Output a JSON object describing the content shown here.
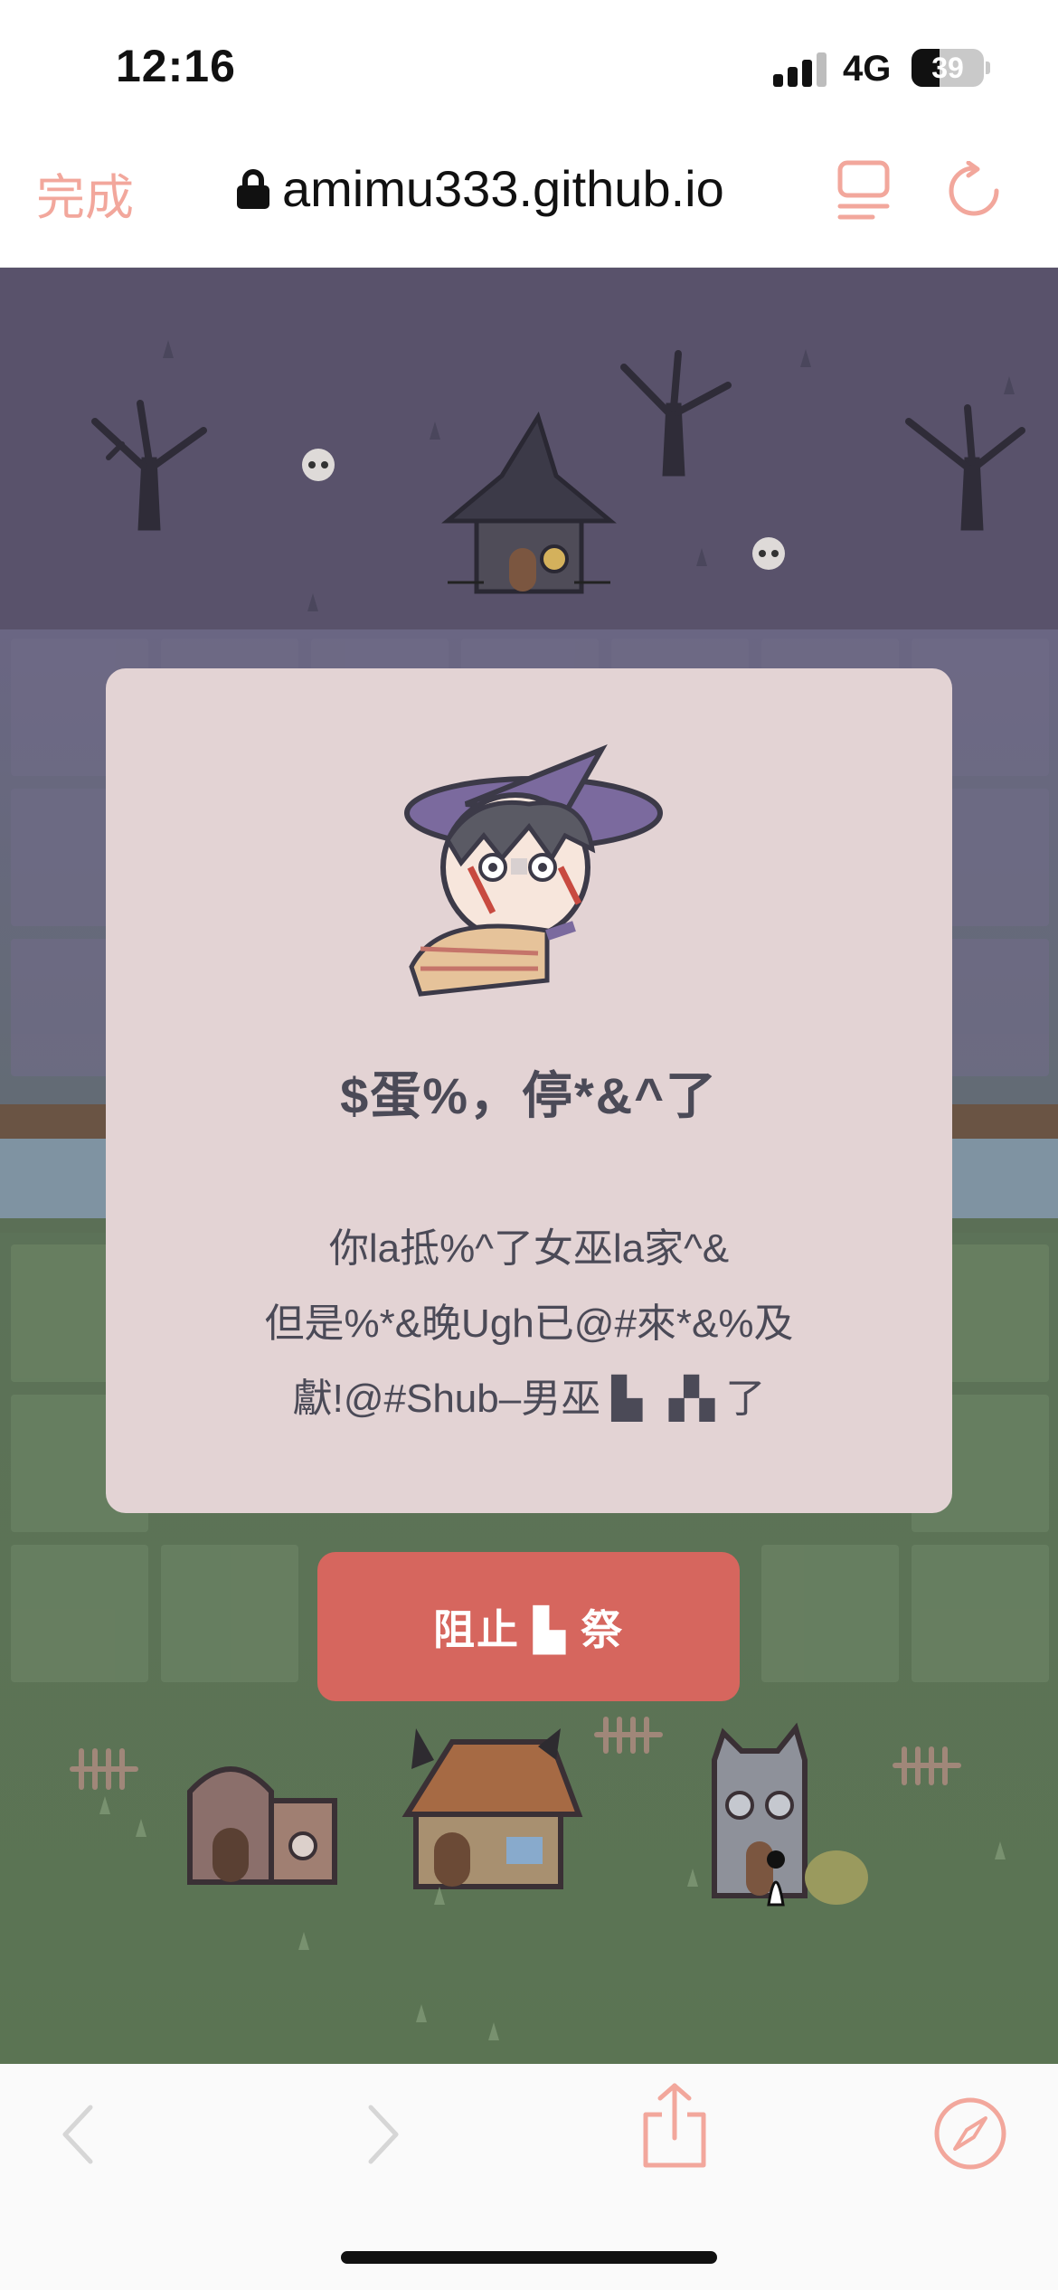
{
  "status_bar": {
    "time": "12:16",
    "network": "4G",
    "battery": "39"
  },
  "browser": {
    "done_label": "完成",
    "url": "amimu333.github.io"
  },
  "modal": {
    "title": "$蛋%，停*&^了",
    "lines": [
      "你la抵%^了女巫la家^&",
      "但是%*&晚Ugh已@#來*&%及",
      "獻!@#Shub–男巫 ▙ ▗▚ 了"
    ]
  },
  "actions": {
    "stop_label": "阻止 ▙ 祭"
  },
  "colors": {
    "accent": "#f2a79c",
    "button": "#d6665e",
    "modal_bg": "#e3d3d4",
    "text": "#4b4a57",
    "sky": "#59526b",
    "grass": "#5b7453",
    "river": "#7f93a2"
  }
}
